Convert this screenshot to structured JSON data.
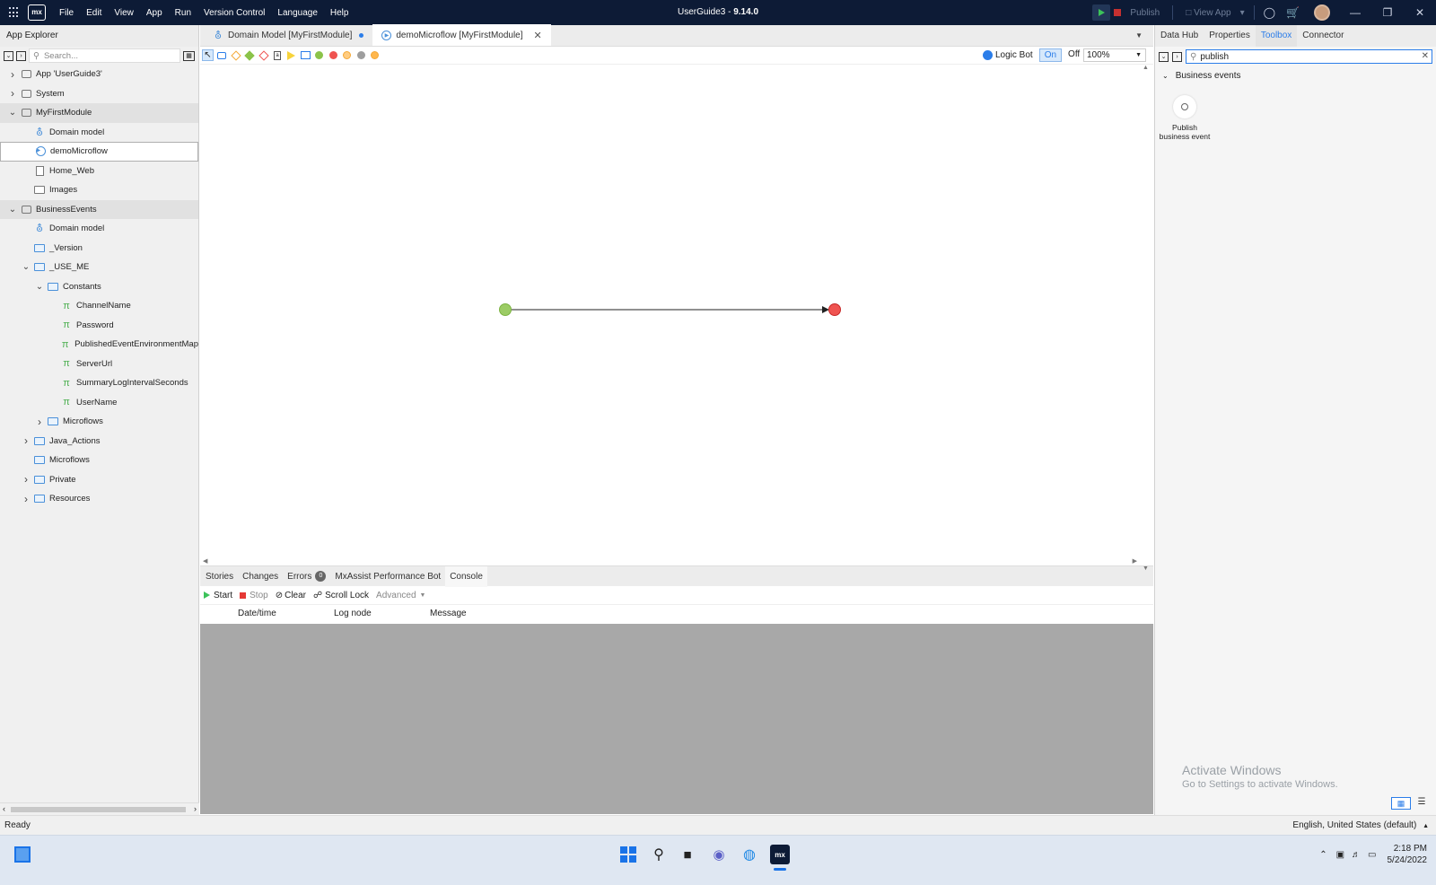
{
  "titlebar": {
    "title": "UserGuide3",
    "separator": " - ",
    "version": "9.14.0",
    "menu": [
      "File",
      "Edit",
      "View",
      "App",
      "Run",
      "Version Control",
      "Language",
      "Help"
    ],
    "publish_label": "Publish",
    "view_app_label": "View App",
    "logo_text": "mx"
  },
  "app_explorer": {
    "title": "App Explorer",
    "search_placeholder": "Search...",
    "tree": [
      {
        "label": "App 'UserGuide3'",
        "level": 0,
        "chevron": "right",
        "icon": "app-icon"
      },
      {
        "label": "System",
        "level": 0,
        "chevron": "right",
        "icon": "module-icon"
      },
      {
        "label": "MyFirstModule",
        "level": 0,
        "chevron": "down",
        "icon": "module-icon",
        "selected": true
      },
      {
        "label": "Domain model",
        "level": 1,
        "icon": "domain-model-icon"
      },
      {
        "label": "demoMicroflow",
        "level": 1,
        "icon": "microflow-icon",
        "current": true
      },
      {
        "label": "Home_Web",
        "level": 1,
        "icon": "page-icon"
      },
      {
        "label": "Images",
        "level": 1,
        "icon": "images-icon"
      },
      {
        "label": "BusinessEvents",
        "level": 0,
        "chevron": "down",
        "icon": "module-icon",
        "selected": true
      },
      {
        "label": "Domain model",
        "level": 1,
        "icon": "domain-model-icon"
      },
      {
        "label": "_Version",
        "level": 1,
        "icon": "folder-icon"
      },
      {
        "label": "_USE_ME",
        "level": 1,
        "chevron": "down",
        "icon": "folder-icon"
      },
      {
        "label": "Constants",
        "level": 2,
        "chevron": "down",
        "icon": "folder-icon"
      },
      {
        "label": "ChannelName",
        "level": 3,
        "icon": "constant-icon"
      },
      {
        "label": "Password",
        "level": 3,
        "icon": "constant-icon"
      },
      {
        "label": "PublishedEventEnvironmentMap",
        "level": 3,
        "icon": "constant-icon"
      },
      {
        "label": "ServerUrl",
        "level": 3,
        "icon": "constant-icon"
      },
      {
        "label": "SummaryLogIntervalSeconds",
        "level": 3,
        "icon": "constant-icon"
      },
      {
        "label": "UserName",
        "level": 3,
        "icon": "constant-icon"
      },
      {
        "label": "Microflows",
        "level": 2,
        "chevron": "right",
        "icon": "folder-icon"
      },
      {
        "label": "Java_Actions",
        "level": 1,
        "chevron": "right",
        "icon": "folder-icon"
      },
      {
        "label": "Microflows",
        "level": 1,
        "icon": "folder-icon"
      },
      {
        "label": "Private",
        "level": 1,
        "chevron": "right",
        "icon": "folder-icon"
      },
      {
        "label": "Resources",
        "level": 1,
        "chevron": "right",
        "icon": "folder-icon"
      }
    ]
  },
  "editor": {
    "tabs": [
      {
        "label": "Domain Model [MyFirstModule]",
        "icon": "domain-model-icon",
        "unsaved": true
      },
      {
        "label": "demoMicroflow [MyFirstModule]",
        "icon": "microflow-icon",
        "active": true,
        "closable": true
      }
    ],
    "logic_bot_label": "Logic Bot",
    "on_label": "On",
    "off_label": "Off",
    "zoom": "100%"
  },
  "bottom_panel": {
    "tabs": [
      "Stories",
      "Changes",
      "Errors",
      "MxAssist Performance Bot",
      "Console"
    ],
    "errors_count": "0",
    "active_tab": "Console",
    "console_buttons": {
      "start": "Start",
      "stop": "Stop",
      "clear": "Clear",
      "scroll_lock": "Scroll Lock",
      "advanced": "Advanced"
    },
    "columns": [
      "Date/time",
      "Log node",
      "Message"
    ]
  },
  "right_panel": {
    "tabs": [
      "Data Hub",
      "Properties",
      "Toolbox",
      "Connector"
    ],
    "active_tab": "Toolbox",
    "search_value": "publish",
    "category": "Business events",
    "tool_label": "Publish business event",
    "watermark_title": "Activate Windows",
    "watermark_sub": "Go to Settings to activate Windows."
  },
  "statusbar": {
    "status": "Ready",
    "language": "English, United States (default)"
  },
  "taskbar": {
    "time": "2:18 PM",
    "date": "5/24/2022"
  },
  "colors": {
    "titlebar_bg": "#0d1b36",
    "accent": "#2b7de9",
    "start_event": "#8bc34a",
    "end_event": "#ef5350"
  }
}
